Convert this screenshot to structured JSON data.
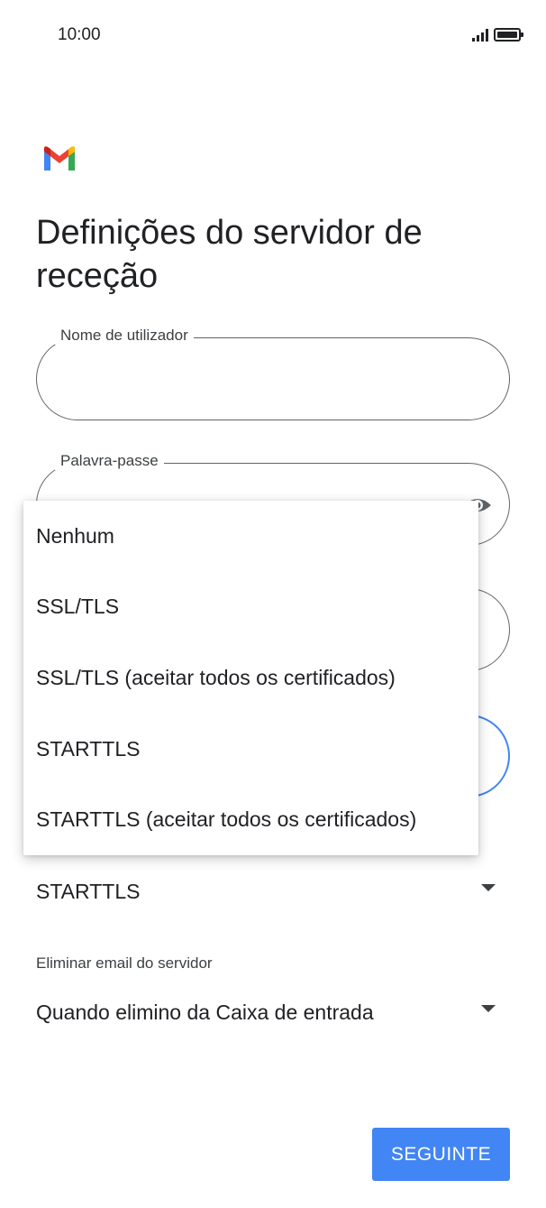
{
  "status_bar": {
    "time": "10:00"
  },
  "header": {
    "title": "Definições do servidor de receção"
  },
  "fields": {
    "username": {
      "label": "Nome de utilizador",
      "value": ""
    },
    "password": {
      "label": "Palavra-passe",
      "value": ""
    },
    "server": {
      "value": ""
    },
    "port": {
      "value": ""
    }
  },
  "security": {
    "selected": "STARTTLS"
  },
  "security_menu": {
    "items": [
      "Nenhum",
      "SSL/TLS",
      "SSL/TLS (aceitar todos os certificados)",
      "STARTTLS",
      "STARTTLS (aceitar todos os certificados)"
    ]
  },
  "delete_email": {
    "label": "Eliminar email do servidor",
    "selected": "Quando elimino da Caixa de entrada"
  },
  "footer": {
    "next_label": "SEGUINTE"
  },
  "colors": {
    "accent": "#4285f4",
    "text": "#202124",
    "outline": "#5f6368"
  },
  "icons": [
    "gmail-logo-icon",
    "eye-icon",
    "signal-icon",
    "battery-icon",
    "dropdown-arrow-icon"
  ]
}
